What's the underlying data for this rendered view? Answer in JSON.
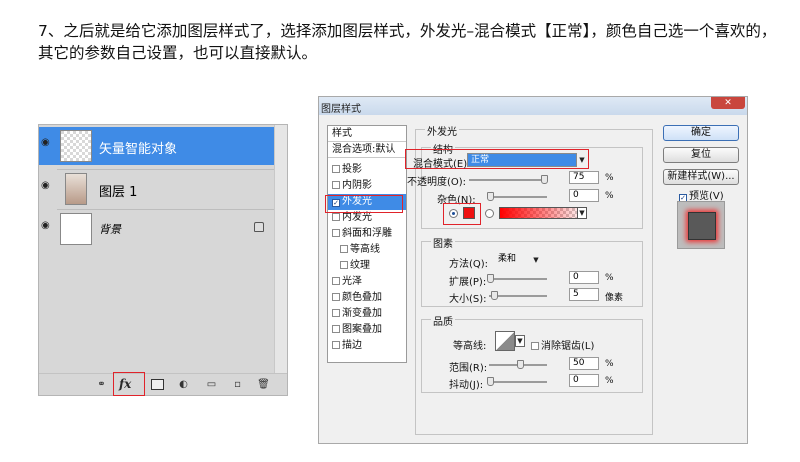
{
  "instruction": "7、之后就是给它添加图层样式了，选择添加图层样式，外发光–混合模式【正常】，颜色自己选一个喜欢的，其它的参数自己设置，也可以直接默认。",
  "layers": [
    {
      "name": "矢量智能对象",
      "selected": true
    },
    {
      "name": "图层 1",
      "selected": false
    },
    {
      "name": "背景",
      "selected": false
    }
  ],
  "layers_bottom": {
    "fx_label": "fx"
  },
  "dialog": {
    "title": "图层样式",
    "style_list": [
      {
        "label": "样式",
        "checkbox": false
      },
      {
        "label": "混合选项:默认",
        "checkbox": false
      },
      {
        "label": "投影",
        "checkbox": true,
        "checked": false
      },
      {
        "label": "内阴影",
        "checkbox": true,
        "checked": false
      },
      {
        "label": "外发光",
        "checkbox": true,
        "checked": true,
        "selected": true
      },
      {
        "label": "内发光",
        "checkbox": true,
        "checked": false
      },
      {
        "label": "斜面和浮雕",
        "checkbox": true,
        "checked": false
      },
      {
        "label": "等高线",
        "checkbox": true,
        "checked": false,
        "indent": true
      },
      {
        "label": "纹理",
        "checkbox": true,
        "checked": false,
        "indent": true
      },
      {
        "label": "光泽",
        "checkbox": true,
        "checked": false
      },
      {
        "label": "颜色叠加",
        "checkbox": true,
        "checked": false
      },
      {
        "label": "渐变叠加",
        "checkbox": true,
        "checked": false
      },
      {
        "label": "图案叠加",
        "checkbox": true,
        "checked": false
      },
      {
        "label": "描边",
        "checkbox": true,
        "checked": false
      }
    ],
    "outer_glow": {
      "group_title": "外发光",
      "structure": {
        "title": "结构",
        "blend_mode_label": "混合模式(E):",
        "blend_mode_value": "正常",
        "opacity_label": "不透明度(O):",
        "opacity_value": "75",
        "noise_label": "杂色(N):",
        "noise_value": "0",
        "unit": "%",
        "glow_color": "#ee1111"
      },
      "elements": {
        "title": "图素",
        "technique_label": "方法(Q):",
        "technique_value": "柔和",
        "spread_label": "扩展(P):",
        "spread_value": "0",
        "size_label": "大小(S):",
        "size_value": "5",
        "size_unit": "像素",
        "unit": "%"
      },
      "quality": {
        "title": "品质",
        "contour_label": "等高线:",
        "antialias_label": "消除锯齿(L)",
        "range_label": "范围(R):",
        "range_value": "50",
        "jitter_label": "抖动(J):",
        "jitter_value": "0",
        "unit": "%"
      }
    },
    "buttons": {
      "ok": "确定",
      "reset": "复位",
      "new_style": "新建样式(W)...",
      "preview": "预览(V)"
    }
  }
}
